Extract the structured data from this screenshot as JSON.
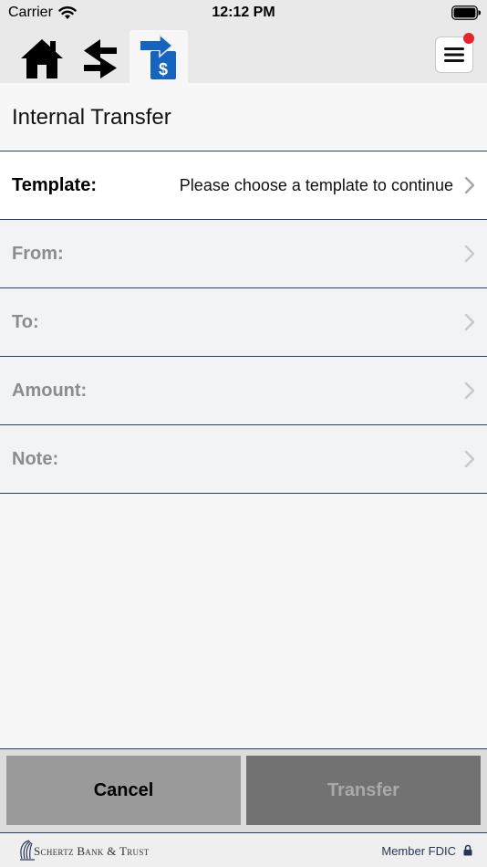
{
  "status_bar": {
    "carrier": "Carrier",
    "time": "12:12 PM"
  },
  "nav": {
    "tabs": [
      {
        "icon": "home-icon",
        "active": false
      },
      {
        "icon": "transfer-arrows-icon",
        "active": false
      },
      {
        "icon": "internal-transfer-icon",
        "active": true
      }
    ],
    "menu_icon": "hamburger-menu-icon",
    "menu_has_badge": true
  },
  "page": {
    "title": "Internal Transfer"
  },
  "form": {
    "rows": [
      {
        "label": "Template:",
        "value": "Please choose a template to continue",
        "enabled": true
      },
      {
        "label": "From:",
        "value": "",
        "enabled": false
      },
      {
        "label": "To:",
        "value": "",
        "enabled": false
      },
      {
        "label": "Amount:",
        "value": "",
        "enabled": false
      },
      {
        "label": "Note:",
        "value": "",
        "enabled": false
      }
    ]
  },
  "actions": {
    "cancel_label": "Cancel",
    "transfer_label": "Transfer",
    "transfer_enabled": false
  },
  "footer": {
    "bank_name": "Schertz Bank & Trust",
    "fdic_text": "Member FDIC"
  },
  "colors": {
    "accent": "#1565c0",
    "divider": "#2c4063",
    "badge": "#e8242b"
  }
}
